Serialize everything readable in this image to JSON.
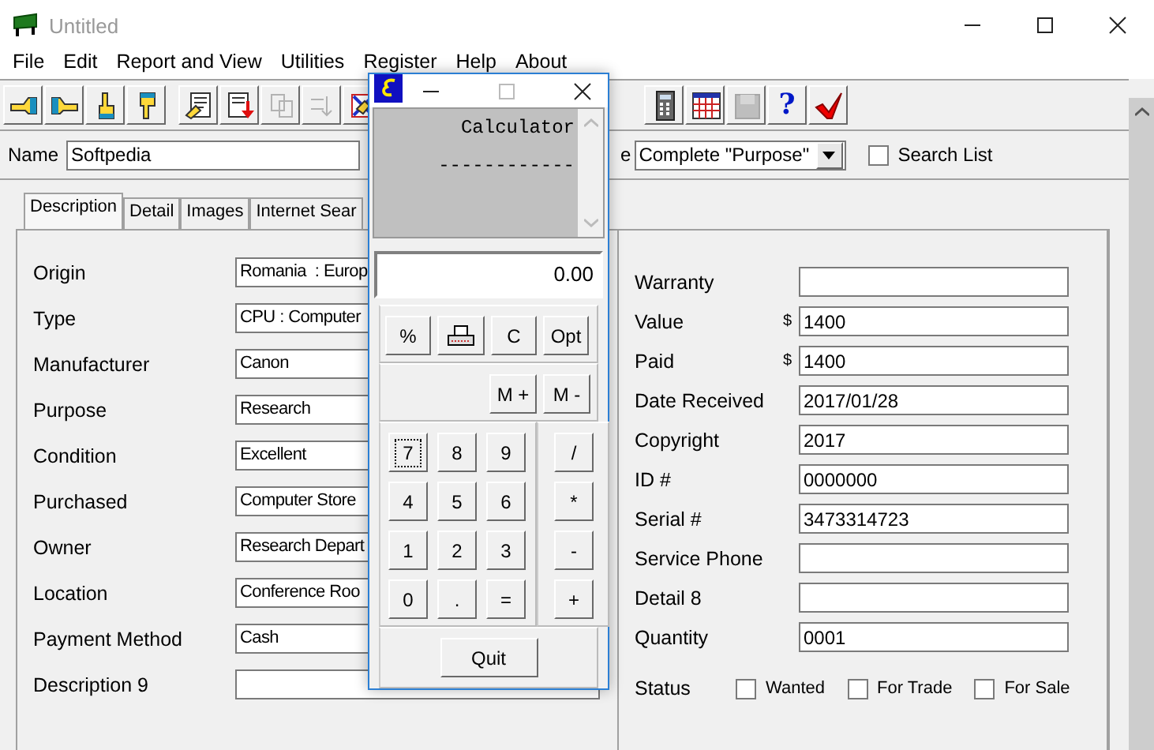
{
  "window": {
    "title": "Untitled"
  },
  "menu": [
    "File",
    "Edit",
    "Report and View",
    "Utilities",
    "Register",
    "Help",
    "About"
  ],
  "toolbar": [
    [
      {
        "kind": "point-left",
        "disabled": false
      },
      {
        "kind": "point-right",
        "disabled": false
      },
      {
        "kind": "point-up",
        "disabled": false
      },
      {
        "kind": "point-down",
        "disabled": false
      }
    ],
    [
      {
        "kind": "edit",
        "disabled": false
      },
      {
        "kind": "import",
        "disabled": false
      },
      {
        "kind": "find",
        "disabled": true
      },
      {
        "kind": "sort",
        "disabled": true
      },
      {
        "kind": "clear",
        "disabled": false
      }
    ],
    [
      {
        "kind": "calculator",
        "disabled": false
      },
      {
        "kind": "calendar",
        "disabled": false
      },
      {
        "kind": "save",
        "disabled": true
      },
      {
        "kind": "help",
        "disabled": false,
        "glyph": "?"
      },
      {
        "kind": "check",
        "disabled": false
      }
    ]
  ],
  "name_row": {
    "label": "Name",
    "value": "Softpedia",
    "search_label": "e",
    "search_mode": "Complete \"Purpose\"",
    "search_list": {
      "label": "Search List",
      "checked": false
    }
  },
  "tabs": [
    {
      "label": "Description",
      "selected": true
    },
    {
      "label": "Detail",
      "selected": false
    },
    {
      "label": "Images",
      "selected": false
    },
    {
      "label": "Internet Sear",
      "selected": false
    }
  ],
  "left_fields": [
    {
      "label": "Origin",
      "value": "Romania  : Europ"
    },
    {
      "label": "Type",
      "value": "CPU : Computer"
    },
    {
      "label": "Manufacturer",
      "value": "Canon"
    },
    {
      "label": "Purpose",
      "value": "Research"
    },
    {
      "label": "Condition",
      "value": "Excellent"
    },
    {
      "label": "Purchased",
      "value": "Computer Store"
    },
    {
      "label": "Owner",
      "value": "Research Depart"
    },
    {
      "label": "Location",
      "value": "Conference Roo"
    },
    {
      "label": "Payment Method",
      "value": "Cash"
    },
    {
      "label": "Description 9"
    }
  ],
  "right_fields": [
    {
      "label": "Warranty"
    },
    {
      "label": "Value",
      "prefix": "$",
      "value": "1400"
    },
    {
      "label": "Paid",
      "prefix": "$",
      "value": "1400"
    },
    {
      "label": "Date Received",
      "value": "2017/01/28"
    },
    {
      "label": "Copyright",
      "value": "2017"
    },
    {
      "label": "ID #",
      "value": "0000000"
    },
    {
      "label": "Serial #",
      "value": "3473314723"
    },
    {
      "label": "Service Phone"
    },
    {
      "label": "Detail 8"
    },
    {
      "label": "Quantity",
      "value": "0001"
    }
  ],
  "status": {
    "label": "Status",
    "options": [
      {
        "label": "Wanted",
        "checked": false
      },
      {
        "label": "For Trade",
        "checked": false
      },
      {
        "label": "For Sale",
        "checked": false
      }
    ]
  },
  "calculator": {
    "tape": [
      "Calculator",
      "------------"
    ],
    "display": "0.00",
    "top_keys": [
      {
        "kind": "text",
        "label": "%"
      },
      {
        "kind": "print"
      },
      {
        "kind": "text",
        "label": "C"
      },
      {
        "kind": "text",
        "label": "Opt"
      }
    ],
    "memory_keys": [
      "M +",
      "M -"
    ],
    "digits": [
      {
        "label": "7",
        "focused": true
      },
      {
        "label": "8",
        "focused": false
      },
      {
        "label": "9",
        "focused": false
      },
      {
        "label": "4",
        "focused": false
      },
      {
        "label": "5",
        "focused": false
      },
      {
        "label": "6",
        "focused": false
      },
      {
        "label": "1",
        "focused": false
      },
      {
        "label": "2",
        "focused": false
      },
      {
        "label": "3",
        "focused": false
      },
      {
        "label": "0",
        "focused": false
      },
      {
        "label": ".",
        "focused": false
      },
      {
        "label": "=",
        "focused": false
      }
    ],
    "operators": [
      "/",
      "*",
      "-",
      "+"
    ],
    "quit": "Quit"
  }
}
